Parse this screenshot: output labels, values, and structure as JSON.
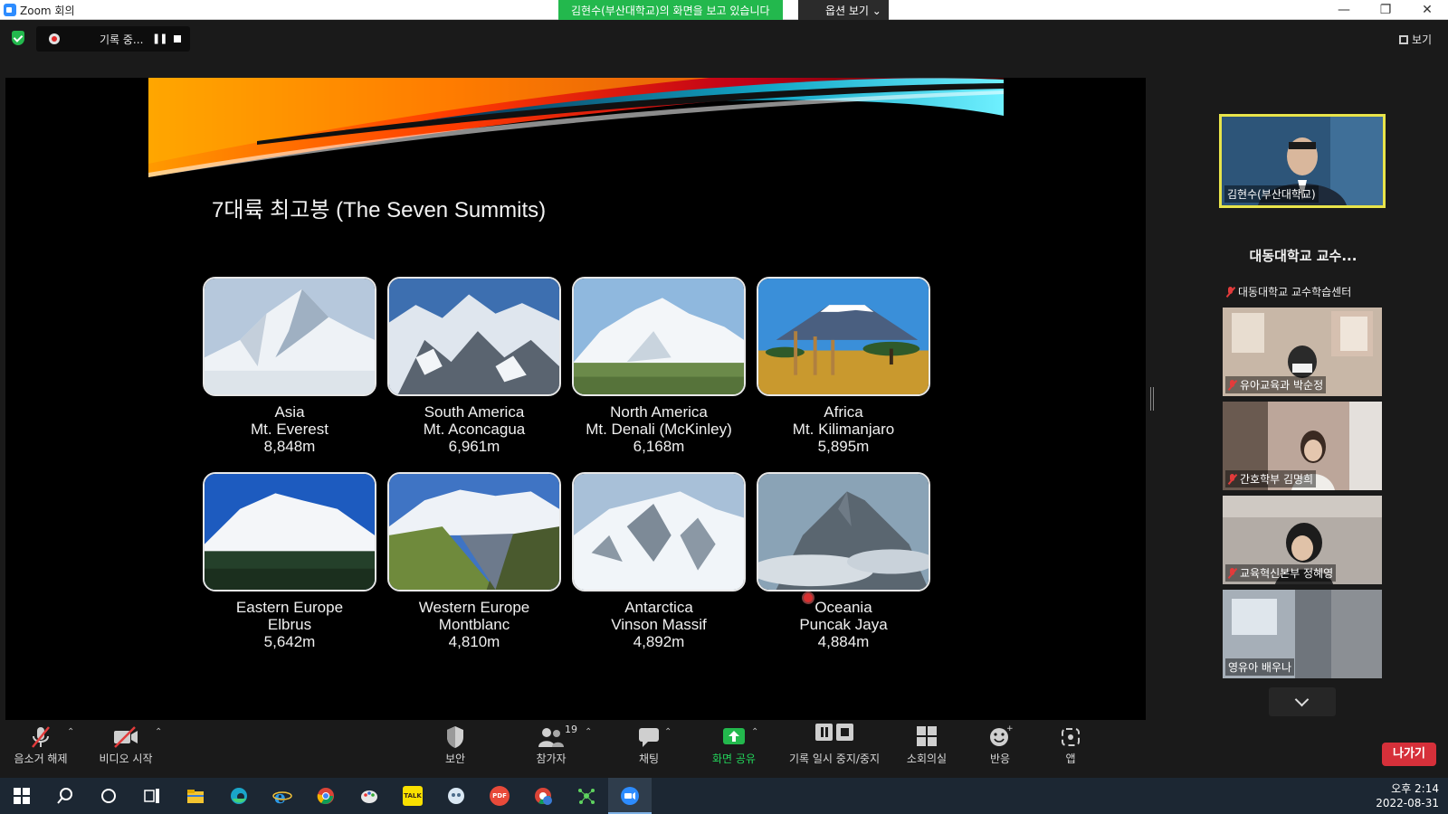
{
  "window": {
    "title": "Zoom 회의",
    "share_banner": "김현수(부산대학교)의 화면을 보고 있습니다",
    "view_options": "옵션 보기 ⌄",
    "minimize": "—",
    "restore": "❐",
    "close": "✕"
  },
  "topbar": {
    "recording_label": "기록 중...",
    "pause_glyph": "❚❚",
    "view_label": "보기"
  },
  "slide": {
    "title": "7대륙 최고봉 (The Seven Summits)",
    "summits": [
      {
        "continent": "Asia",
        "mountain": "Mt. Everest",
        "height": "8,848m"
      },
      {
        "continent": "South America",
        "mountain": "Mt. Aconcagua",
        "height": "6,961m"
      },
      {
        "continent": "North America",
        "mountain": "Mt. Denali (McKinley)",
        "height": "6,168m"
      },
      {
        "continent": "Africa",
        "mountain": "Mt. Kilimanjaro",
        "height": "5,895m"
      },
      {
        "continent": "Eastern Europe",
        "mountain": "Elbrus",
        "height": "5,642m"
      },
      {
        "continent": "Western Europe",
        "mountain": "Montblanc",
        "height": "4,810m"
      },
      {
        "continent": "Antarctica",
        "mountain": "Vinson Massif",
        "height": "4,892m"
      },
      {
        "continent": "Oceania",
        "mountain": "Puncak Jaya",
        "height": "4,884m"
      }
    ]
  },
  "participants": {
    "speaker_name": "김현수(부산대학교)",
    "text_tile_title": "대동대학교 교수...",
    "text_tile_name": "대동대학교 교수학습센터",
    "videos": [
      {
        "name": "유아교육과 박순정"
      },
      {
        "name": "간호학부 김명희"
      },
      {
        "name": "교육혁신본부 정혜영"
      },
      {
        "name": "영유아 배우나"
      }
    ]
  },
  "toolbar": {
    "unmute": "음소거 해제",
    "start_video": "비디오 시작",
    "security": "보안",
    "participants": "참가자",
    "participant_count": "19",
    "chat": "채팅",
    "share_screen": "화면 공유",
    "pause_stop_recording": "기록 일시 중지/중지",
    "breakout_rooms": "소회의실",
    "reactions": "반응",
    "apps": "앱",
    "leave": "나가기"
  },
  "taskbar": {
    "time": "오후 2:14",
    "date": "2022-08-31",
    "kakaotalk_badge": "TALK",
    "pdf_badge": "PDF"
  },
  "colors": {
    "share_green": "#23b84d",
    "speaker_border": "#e8e44a",
    "leave_red": "#d6303a",
    "muted_red": "#e23b3b"
  }
}
